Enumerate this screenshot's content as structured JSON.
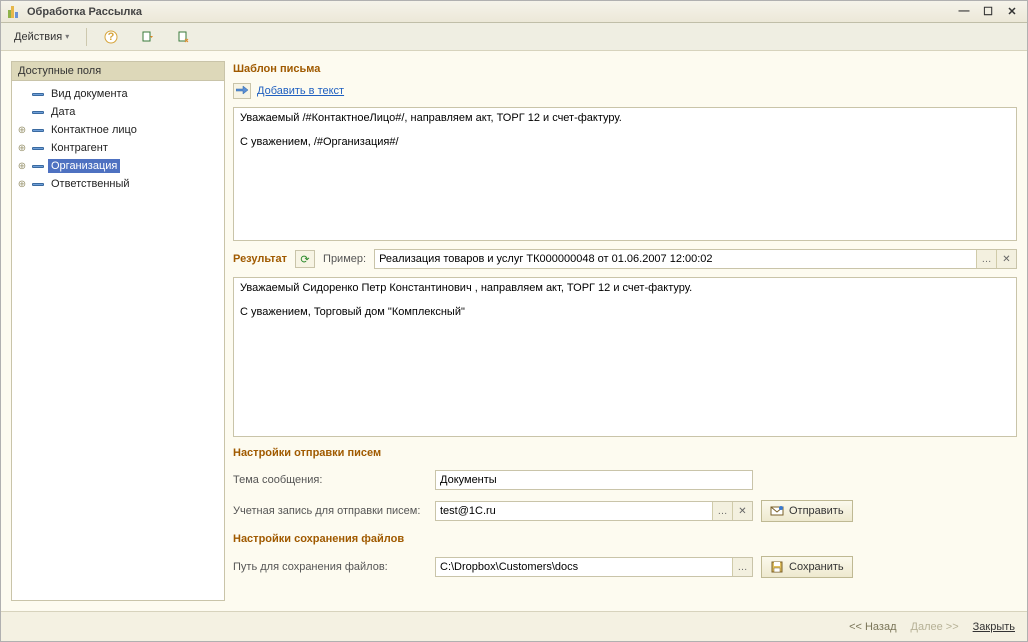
{
  "window": {
    "title": "Обработка  Рассылка"
  },
  "toolbar": {
    "actions_label": "Действия"
  },
  "left_pane": {
    "header": "Доступные поля",
    "items": [
      {
        "label": "Вид документа",
        "expandable": false
      },
      {
        "label": "Дата",
        "expandable": false
      },
      {
        "label": "Контактное лицо",
        "expandable": true
      },
      {
        "label": "Контрагент",
        "expandable": true
      },
      {
        "label": "Организация",
        "expandable": true,
        "selected": true
      },
      {
        "label": "Ответственный",
        "expandable": true
      }
    ]
  },
  "template": {
    "title": "Шаблон письма",
    "add_to_text": "Добавить в текст",
    "body": "Уважаемый /#КонтактноеЛицо#/, направляем акт, ТОРГ 12 и счет-фактуру.\n\nС уважением, /#Организация#/"
  },
  "result": {
    "title": "Результат",
    "example_label": "Пример:",
    "example_value": "Реализация товаров и услуг ТК000000048 от 01.06.2007 12:00:02",
    "body": "Уважаемый Сидоренко Петр Константинович , направляем акт, ТОРГ 12 и счет-фактуру.\n\nС уважением, Торговый дом \"Комплексный\""
  },
  "send_settings": {
    "title": "Настройки отправки писем",
    "subject_label": "Тема сообщения:",
    "subject_value": "Документы",
    "account_label": "Учетная запись для отправки писем:",
    "account_value": "test@1C.ru",
    "send_btn": "Отправить"
  },
  "save_settings": {
    "title": "Настройки сохранения файлов",
    "path_label": "Путь для сохранения файлов:",
    "path_value": "C:\\Dropbox\\Customers\\docs",
    "save_btn": "Сохранить"
  },
  "footer": {
    "back": "<< Назад",
    "next": "Далее >>",
    "close": "Закрыть"
  }
}
